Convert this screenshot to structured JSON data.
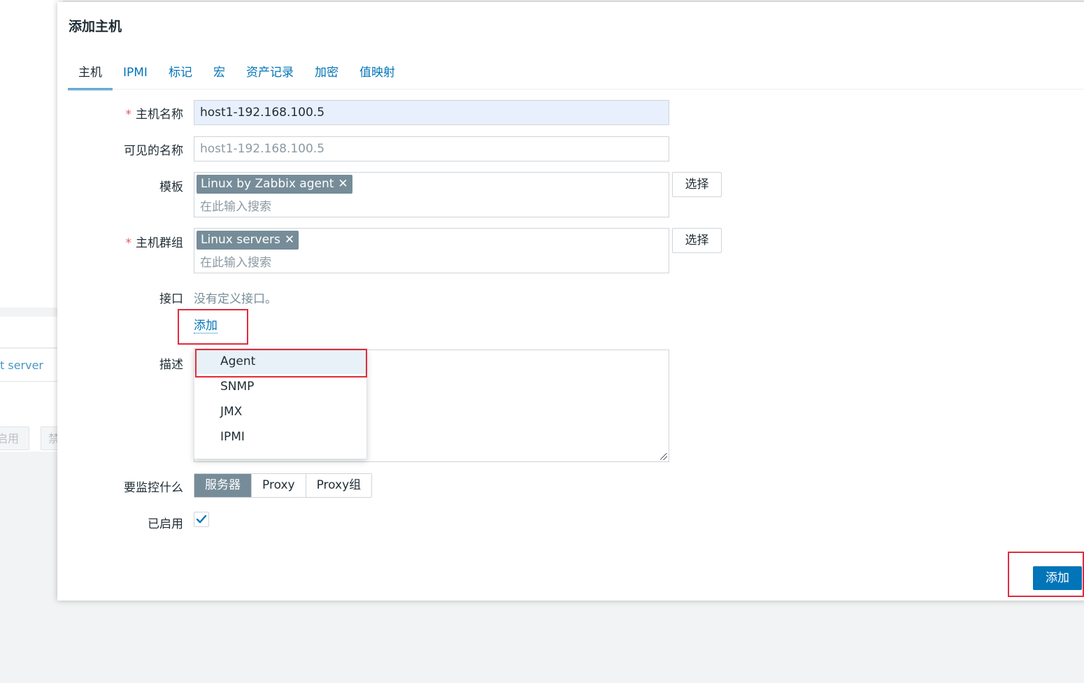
{
  "background": {
    "link_text": "t server",
    "btn1": "启用",
    "btn2": "禁"
  },
  "dialog": {
    "title": "添加主机",
    "tabs": [
      "主机",
      "IPMI",
      "标记",
      "宏",
      "资产记录",
      "加密",
      "值映射"
    ],
    "active_tab": "主机",
    "host_name": {
      "label": "主机名称",
      "value": "host1-192.168.100.5",
      "required": true
    },
    "visible_name": {
      "label": "可见的名称",
      "placeholder": "host1-192.168.100.5"
    },
    "templates": {
      "label": "模板",
      "chips": [
        "Linux by Zabbix agent"
      ],
      "search_placeholder": "在此输入搜索",
      "select_label": "选择"
    },
    "host_groups": {
      "label": "主机群组",
      "chips": [
        "Linux servers"
      ],
      "search_placeholder": "在此输入搜索",
      "select_label": "选择",
      "required": true
    },
    "interfaces": {
      "label": "接口",
      "empty_text": "没有定义接口。",
      "add_label": "添加"
    },
    "interface_menu": [
      "Agent",
      "SNMP",
      "JMX",
      "IPMI"
    ],
    "description": {
      "label": "描述"
    },
    "monitored_by": {
      "label": "要监控什么",
      "options": [
        "服务器",
        "Proxy",
        "Proxy组"
      ],
      "selected": "服务器"
    },
    "enabled": {
      "label": "已启用",
      "checked": true
    },
    "submit_label": "添加",
    "required_mark": "*",
    "chip_remove_glyph": "✕"
  },
  "colors": {
    "accent": "#0275b8",
    "chip": "#768d99",
    "annotation": "#e02b3c"
  }
}
